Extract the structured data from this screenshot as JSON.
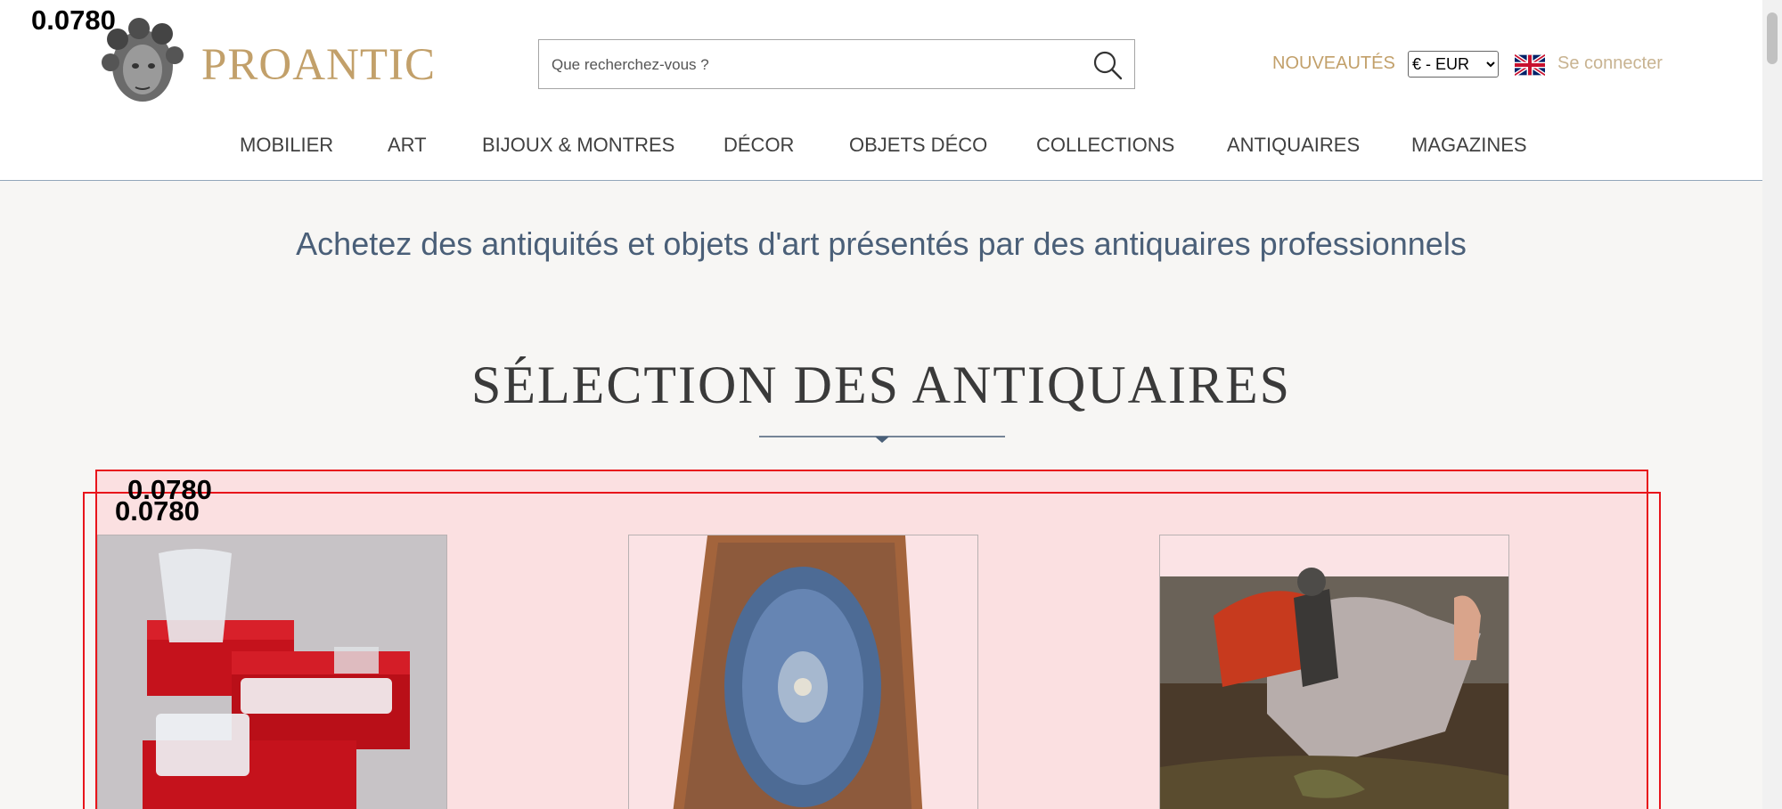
{
  "header": {
    "logo_text": "PROANTIC",
    "search_placeholder": "Que recherchez-vous ?",
    "new_link": "NOUVEAUTÉS",
    "currency_selected": "€ - EUR",
    "login_label": "Se connecter",
    "icons": {
      "search": "search-icon",
      "flag": "uk-flag-icon",
      "logo": "medusa-bust-logo"
    }
  },
  "nav": {
    "items": [
      "MOBILIER",
      "ART",
      "BIJOUX & MONTRES",
      "DÉCOR",
      "OBJETS DÉCO",
      "COLLECTIONS",
      "ANTIQUAIRES",
      "MAGAZINES"
    ]
  },
  "main": {
    "tagline": "Achetez des antiquités et objets d'art présentés par des antiquaires professionnels",
    "section_title": "SÉLECTION DES ANTIQUAIRES",
    "products": [
      {
        "image": "red-boxes-baccarat-crystal"
      },
      {
        "image": "persian-silk-rug"
      },
      {
        "image": "saint-george-dragon-painting"
      }
    ]
  },
  "overlays": {
    "labels": [
      "0.0780",
      "0.0780",
      "0.0780"
    ]
  },
  "colors": {
    "accent_gold": "#c2a06a",
    "tagline_blue": "#4a5f78",
    "overlay_red": "#e8141b"
  }
}
